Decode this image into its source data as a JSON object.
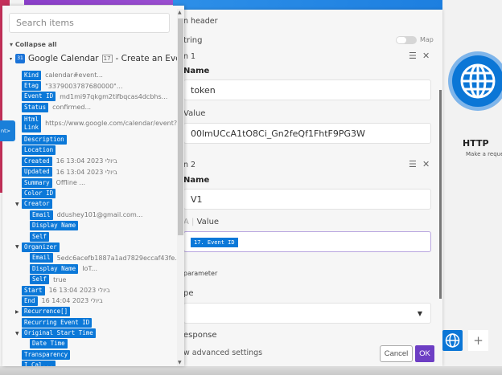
{
  "mapper": {
    "search_placeholder": "Search items",
    "collapse_all": "Collapse all",
    "module": {
      "icon_text": "31",
      "name": "Google Calendar",
      "number": "17",
      "action": "- Create an Event"
    },
    "items": [
      {
        "tag": "Kind",
        "value": "calendar#event...",
        "level": 1
      },
      {
        "tag": "Etag",
        "value": "\"3379003787680000\"...",
        "level": 1
      },
      {
        "tag": "Event ID",
        "value": "md1mi97qkgm2tifbqcas4dcbhs...",
        "level": 1
      },
      {
        "tag": "Status",
        "value": "confirmed...",
        "level": 1
      },
      {
        "tag": "Html Link",
        "value": "https://www.google.com/calendar/event?...",
        "level": 1,
        "two": true
      },
      {
        "tag": "Description",
        "value": "",
        "level": 1
      },
      {
        "tag": "Location",
        "value": "",
        "level": 1
      },
      {
        "tag": "Created",
        "value": "16 13:04 2023 ביולי",
        "level": 1
      },
      {
        "tag": "Updated",
        "value": "16 13:04 2023 ביולי",
        "level": 1
      },
      {
        "tag": "Summary",
        "value": "Offline ...",
        "level": 1
      },
      {
        "tag": "Color ID",
        "value": "",
        "level": 1
      },
      {
        "tag": "Creator",
        "value": "",
        "level": 1,
        "open": true
      },
      {
        "tag": "Email",
        "value": "ddushey101@gmail.com...",
        "level": 2
      },
      {
        "tag": "Display Name",
        "value": "",
        "level": 2
      },
      {
        "tag": "Self",
        "value": "",
        "level": 2
      },
      {
        "tag": "Organizer",
        "value": "",
        "level": 1,
        "open": true
      },
      {
        "tag": "Email",
        "value": "5edc6acefb1887a1ad7829eccaf43fe...",
        "level": 2
      },
      {
        "tag": "Display Name",
        "value": "IoT...",
        "level": 2
      },
      {
        "tag": "Self",
        "value": "true",
        "level": 2
      },
      {
        "tag": "Start",
        "value": "16 13:04 2023 ביולי",
        "level": 1
      },
      {
        "tag": "End",
        "value": "16 14:04 2023 ביולי",
        "level": 1
      },
      {
        "tag": "Recurrence[]",
        "value": "",
        "level": 1,
        "closed": true
      },
      {
        "tag": "Recurring Event ID",
        "value": "",
        "level": 1
      },
      {
        "tag": "Original Start Time",
        "value": "",
        "level": 1,
        "open": true
      },
      {
        "tag": "Date Time",
        "value": "",
        "level": 2
      },
      {
        "tag": "Transparency",
        "value": "",
        "level": 1
      },
      {
        "tag": "I Cal...",
        "value": "",
        "level": 1
      }
    ]
  },
  "tooltip": "nt>",
  "settings": {
    "header_label": "n header",
    "string_label": "tring",
    "map_label": "Map",
    "item1": {
      "label": "n 1",
      "name_label": "Name",
      "name_value": "token",
      "value_label": "Value",
      "value_value": "00lmUCcA1tO8Ci_Gn2feQf1FhtF9PG3W"
    },
    "item2": {
      "label": "n 2",
      "name_label": "Name",
      "name_value": "V1",
      "value_prefix": "A",
      "value_label": "Value",
      "value_tag": "17. Event ID"
    },
    "parameter_label": "parameter",
    "type_label": "pe",
    "response_label": "esponse",
    "advanced_label": "w advanced settings",
    "cancel": "Cancel",
    "ok": "OK"
  },
  "node": {
    "title": "HTTP",
    "subtitle": "Make a reque"
  },
  "colors": {
    "accent": "#0b78d8",
    "ok": "#6d3ec4"
  }
}
